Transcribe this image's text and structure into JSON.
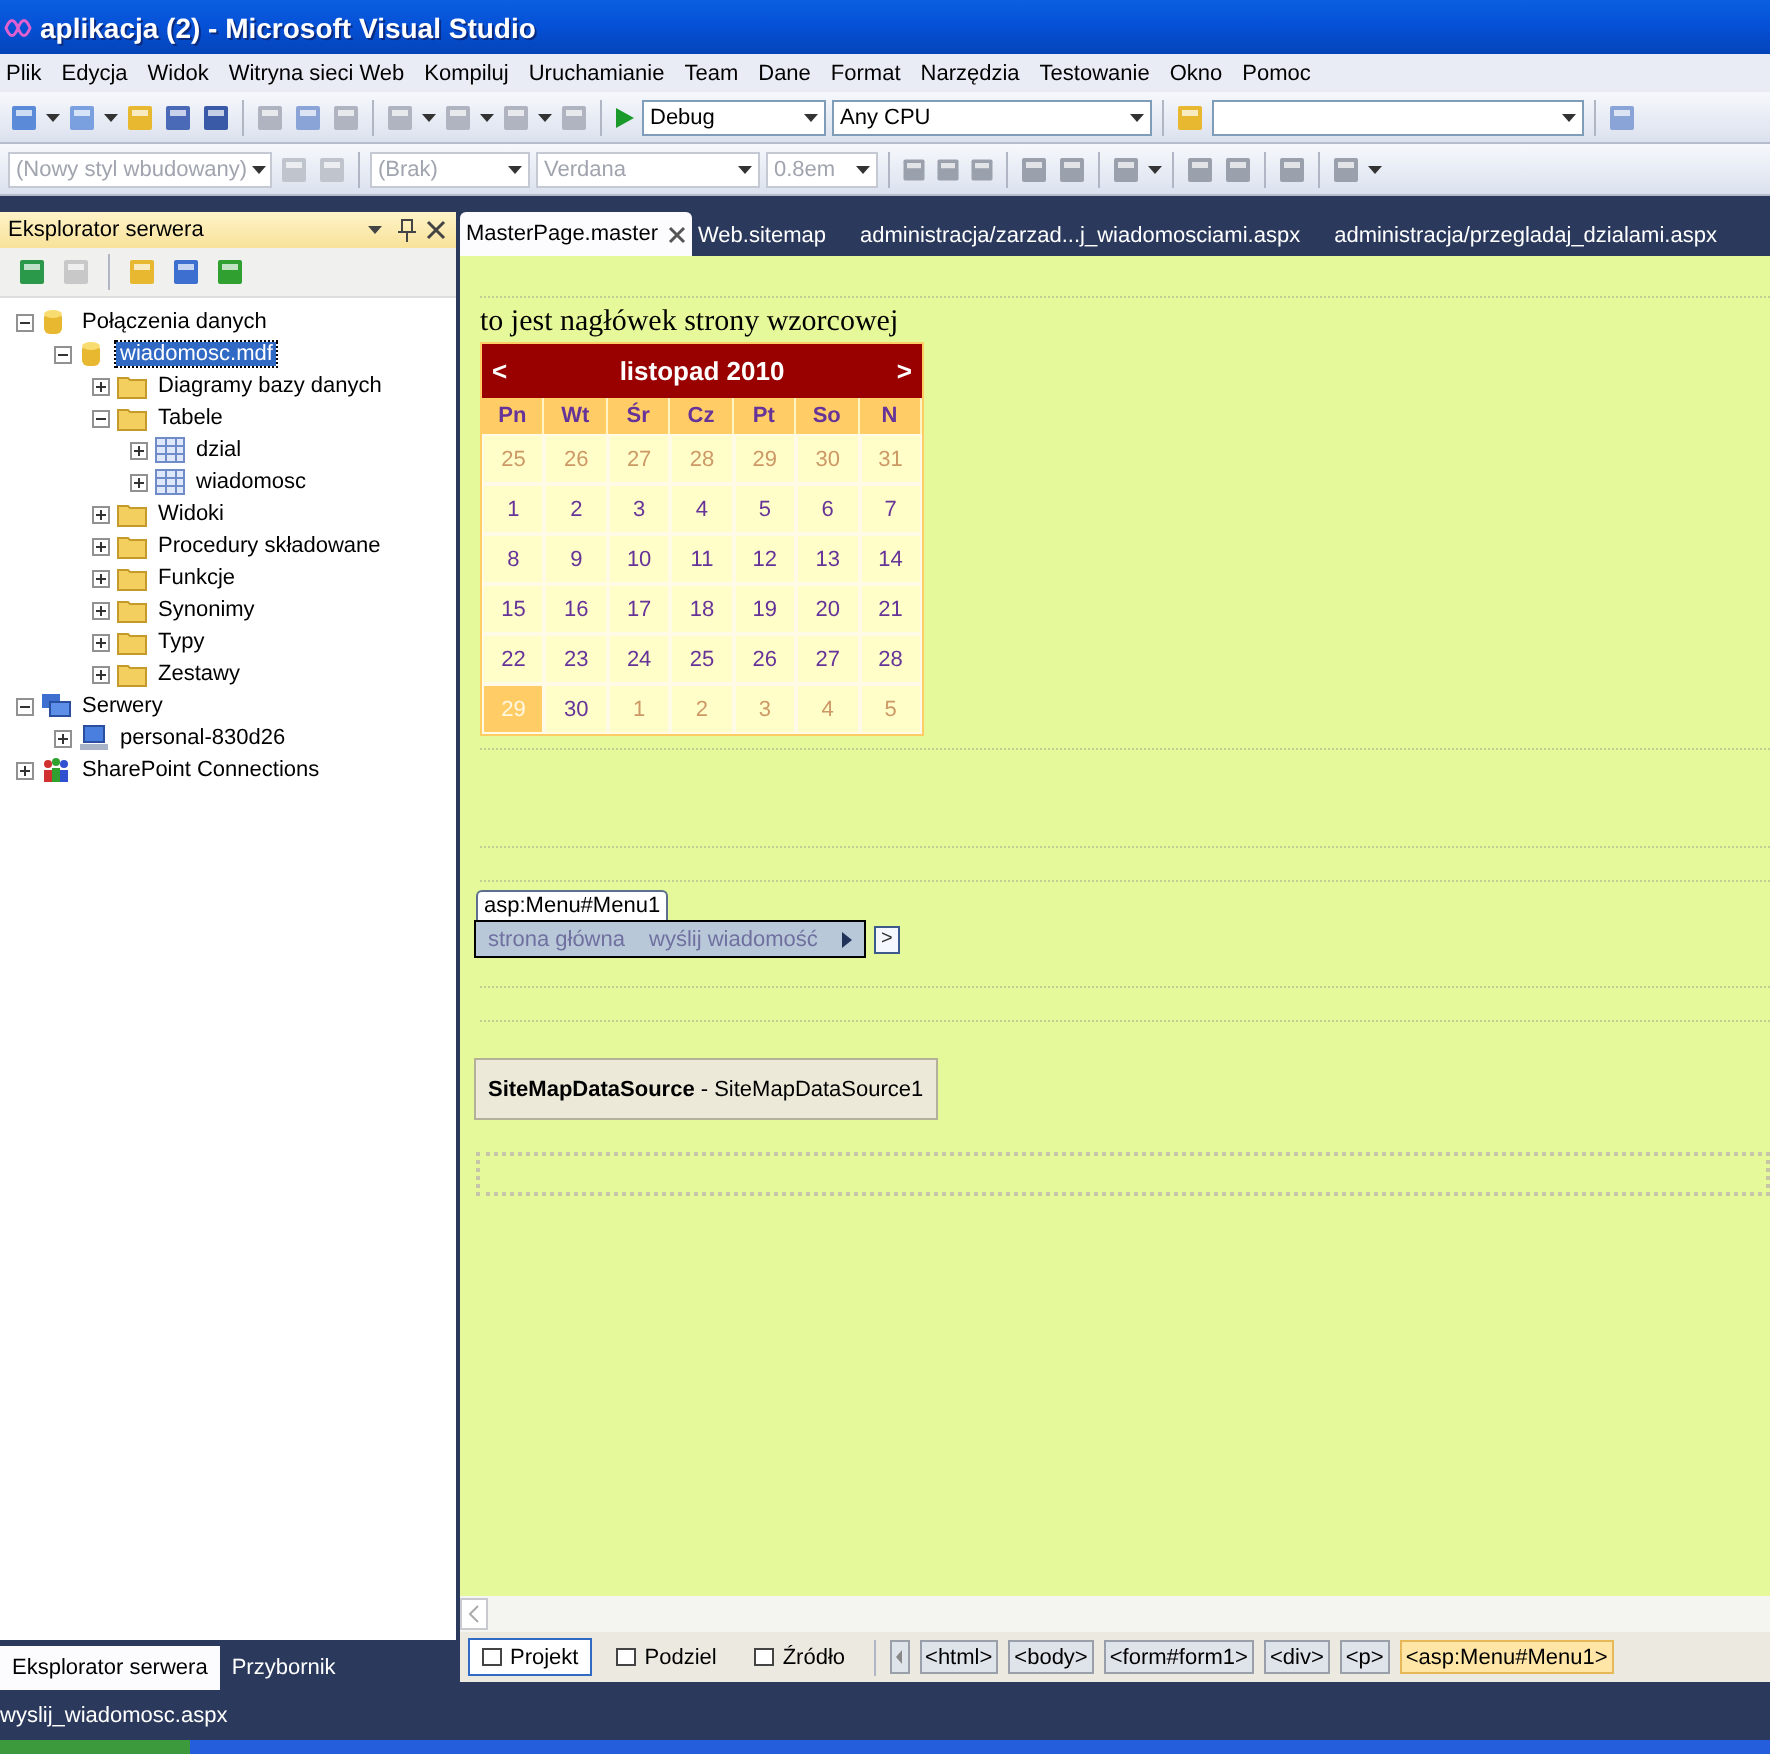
{
  "window": {
    "title": "aplikacja (2) - Microsoft Visual Studio"
  },
  "menu": [
    "Plik",
    "Edycja",
    "Widok",
    "Witryna sieci Web",
    "Kompiluj",
    "Uruchamianie",
    "Team",
    "Dane",
    "Format",
    "Narzędzia",
    "Testowanie",
    "Okno",
    "Pomoc"
  ],
  "toolbar": {
    "configuration": "Debug",
    "platform": "Any CPU",
    "style": "(Nowy styl wbudowany)",
    "block": "(Brak)",
    "font": "Verdana",
    "size": "0.8em"
  },
  "server_explorer": {
    "title": "Eksplorator serwera",
    "tree": [
      {
        "label": "Połączenia danych",
        "kind": "database",
        "expanded": true,
        "selected": false,
        "children": [
          {
            "label": "wiadomosc.mdf",
            "kind": "database",
            "expanded": true,
            "selected": true,
            "children": [
              {
                "label": "Diagramy bazy danych",
                "kind": "folder",
                "expanded": false,
                "selected": false
              },
              {
                "label": "Tabele",
                "kind": "folder",
                "expanded": true,
                "selected": false,
                "children": [
                  {
                    "label": "dzial",
                    "kind": "table",
                    "expanded": false,
                    "selected": false
                  },
                  {
                    "label": "wiadomosc",
                    "kind": "table",
                    "expanded": false,
                    "selected": false
                  }
                ]
              },
              {
                "label": "Widoki",
                "kind": "folder",
                "expanded": false,
                "selected": false
              },
              {
                "label": "Procedury składowane",
                "kind": "folder",
                "expanded": false,
                "selected": false
              },
              {
                "label": "Funkcje",
                "kind": "folder",
                "expanded": false,
                "selected": false
              },
              {
                "label": "Synonimy",
                "kind": "folder",
                "expanded": false,
                "selected": false
              },
              {
                "label": "Typy",
                "kind": "folder",
                "expanded": false,
                "selected": false
              },
              {
                "label": "Zestawy",
                "kind": "folder",
                "expanded": false,
                "selected": false
              }
            ]
          }
        ]
      },
      {
        "label": "Serwery",
        "kind": "servers",
        "expanded": true,
        "selected": false,
        "children": [
          {
            "label": "personal-830d26",
            "kind": "computer",
            "expanded": false,
            "selected": false
          }
        ]
      },
      {
        "label": "SharePoint Connections",
        "kind": "sharepoint",
        "expanded": false,
        "selected": false
      }
    ]
  },
  "panel_tabs": [
    {
      "label": "Eksplorator serwera",
      "selected": true
    },
    {
      "label": "Przybornik",
      "selected": false
    }
  ],
  "document_tabs": [
    {
      "label": "MasterPage.master",
      "selected": true
    },
    {
      "label": "Web.sitemap",
      "selected": false
    },
    {
      "label": "administracja/zarzad...j_wiadomosciami.aspx",
      "selected": false
    },
    {
      "label": "administracja/przegladaj_dzialami.aspx",
      "selected": false
    }
  ],
  "design": {
    "heading": "to jest nagłówek strony wzorcowej",
    "calendar": {
      "prev": "<",
      "title": "listopad 2010",
      "next": ">",
      "day_names": [
        "Pn",
        "Wt",
        "Śr",
        "Cz",
        "Pt",
        "So",
        "N"
      ],
      "weeks": [
        [
          {
            "day": "25",
            "other": true,
            "selected": false
          },
          {
            "day": "26",
            "other": true,
            "selected": false
          },
          {
            "day": "27",
            "other": true,
            "selected": false
          },
          {
            "day": "28",
            "other": true,
            "selected": false
          },
          {
            "day": "29",
            "other": true,
            "selected": false
          },
          {
            "day": "30",
            "other": true,
            "selected": false
          },
          {
            "day": "31",
            "other": true,
            "selected": false
          }
        ],
        [
          {
            "day": "1",
            "other": false,
            "selected": false
          },
          {
            "day": "2",
            "other": false,
            "selected": false
          },
          {
            "day": "3",
            "other": false,
            "selected": false
          },
          {
            "day": "4",
            "other": false,
            "selected": false
          },
          {
            "day": "5",
            "other": false,
            "selected": false
          },
          {
            "day": "6",
            "other": false,
            "selected": false
          },
          {
            "day": "7",
            "other": false,
            "selected": false
          }
        ],
        [
          {
            "day": "8",
            "other": false,
            "selected": false
          },
          {
            "day": "9",
            "other": false,
            "selected": false
          },
          {
            "day": "10",
            "other": false,
            "selected": false
          },
          {
            "day": "11",
            "other": false,
            "selected": false
          },
          {
            "day": "12",
            "other": false,
            "selected": false
          },
          {
            "day": "13",
            "other": false,
            "selected": false
          },
          {
            "day": "14",
            "other": false,
            "selected": false
          }
        ],
        [
          {
            "day": "15",
            "other": false,
            "selected": false
          },
          {
            "day": "16",
            "other": false,
            "selected": false
          },
          {
            "day": "17",
            "other": false,
            "selected": false
          },
          {
            "day": "18",
            "other": false,
            "selected": false
          },
          {
            "day": "19",
            "other": false,
            "selected": false
          },
          {
            "day": "20",
            "other": false,
            "selected": false
          },
          {
            "day": "21",
            "other": false,
            "selected": false
          }
        ],
        [
          {
            "day": "22",
            "other": false,
            "selected": false
          },
          {
            "day": "23",
            "other": false,
            "selected": false
          },
          {
            "day": "24",
            "other": false,
            "selected": false
          },
          {
            "day": "25",
            "other": false,
            "selected": false
          },
          {
            "day": "26",
            "other": false,
            "selected": false
          },
          {
            "day": "27",
            "other": false,
            "selected": false
          },
          {
            "day": "28",
            "other": false,
            "selected": false
          }
        ],
        [
          {
            "day": "29",
            "other": false,
            "selected": true
          },
          {
            "day": "30",
            "other": false,
            "selected": false
          },
          {
            "day": "1",
            "other": true,
            "selected": false
          },
          {
            "day": "2",
            "other": true,
            "selected": false
          },
          {
            "day": "3",
            "other": true,
            "selected": false
          },
          {
            "day": "4",
            "other": true,
            "selected": false
          },
          {
            "day": "5",
            "other": true,
            "selected": false
          }
        ]
      ]
    },
    "menu_control": {
      "tag": "asp:Menu#Menu1",
      "items": [
        "strona główna",
        "wyślij wiadomość"
      ],
      "smart_tag": ">"
    },
    "datasource": "**SiteMapDataSource** - SiteMapDataSource1"
  },
  "views": [
    {
      "label": "Projekt",
      "selected": true
    },
    {
      "label": "Podziel",
      "selected": false
    },
    {
      "label": "Źródło",
      "selected": false
    }
  ],
  "breadcrumb": [
    {
      "label": "<html>",
      "selected": false
    },
    {
      "label": "<body>",
      "selected": false
    },
    {
      "label": "<form#form1>",
      "selected": false
    },
    {
      "label": "<div>",
      "selected": false
    },
    {
      "label": "<p>",
      "selected": false
    },
    {
      "label": "<asp:Menu#Menu1>",
      "selected": true
    }
  ],
  "status_bar": "wyslij_wiadomosc.aspx"
}
